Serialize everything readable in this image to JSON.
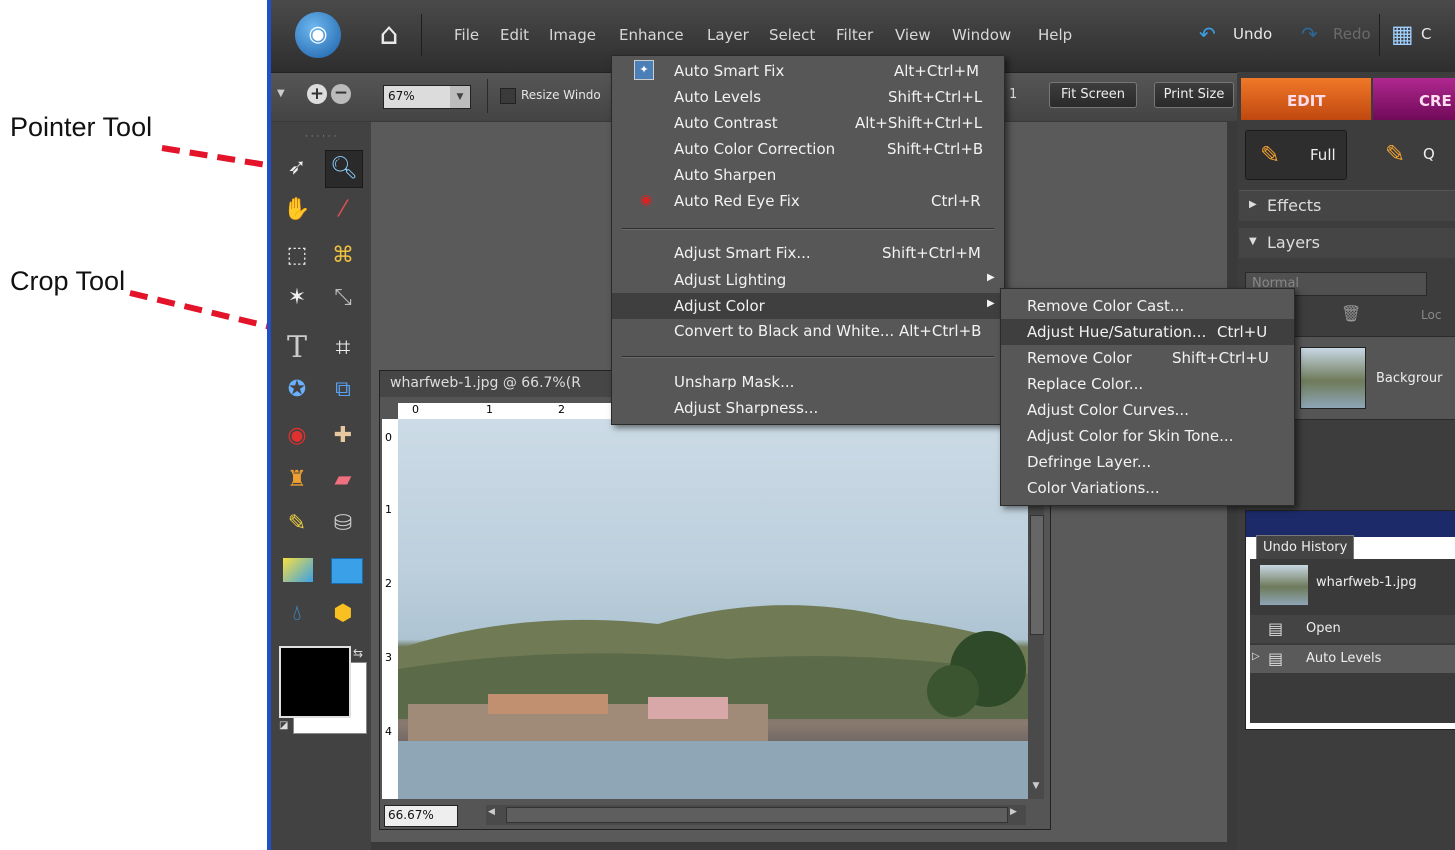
{
  "callouts": {
    "pointer": "Pointer Tool",
    "crop": "Crop Tool"
  },
  "menubar": {
    "items": [
      "File",
      "Edit",
      "Image",
      "Enhance",
      "Layer",
      "Select",
      "Filter",
      "View",
      "Window",
      "Help"
    ],
    "undo": "Undo",
    "redo": "Redo",
    "organizer": "C"
  },
  "options": {
    "zoom": "67%",
    "resize_label": "Resize Windo",
    "fit_screen": "Fit Screen",
    "print_size": "Print Size",
    "partial": "1"
  },
  "tabs": {
    "edit": "EDIT",
    "create": "CRE"
  },
  "panel": {
    "full": "Full",
    "quick": "Q",
    "effects": "Effects",
    "layers": "Layers",
    "blend": "Normal",
    "lock": "Loc",
    "layer_name": "Backgrour"
  },
  "enhance_menu": [
    {
      "label": "Auto Smart Fix",
      "shortcut": "Alt+Ctrl+M"
    },
    {
      "label": "Auto Levels",
      "shortcut": "Shift+Ctrl+L"
    },
    {
      "label": "Auto Contrast",
      "shortcut": "Alt+Shift+Ctrl+L"
    },
    {
      "label": "Auto Color Correction",
      "shortcut": "Shift+Ctrl+B"
    },
    {
      "label": "Auto Sharpen",
      "shortcut": ""
    },
    {
      "label": "Auto Red Eye Fix",
      "shortcut": "Ctrl+R"
    },
    {
      "label": "Adjust Smart Fix...",
      "shortcut": "Shift+Ctrl+M"
    },
    {
      "label": "Adjust Lighting",
      "shortcut": ""
    },
    {
      "label": "Adjust Color",
      "shortcut": ""
    },
    {
      "label": "Convert to Black and White...",
      "shortcut": "Alt+Ctrl+B"
    },
    {
      "label": "Unsharp Mask...",
      "shortcut": ""
    },
    {
      "label": "Adjust Sharpness...",
      "shortcut": ""
    }
  ],
  "color_submenu": [
    {
      "label": "Remove Color Cast...",
      "shortcut": ""
    },
    {
      "label": "Adjust Hue/Saturation...",
      "shortcut": "Ctrl+U"
    },
    {
      "label": "Remove Color",
      "shortcut": "Shift+Ctrl+U"
    },
    {
      "label": "Replace Color...",
      "shortcut": ""
    },
    {
      "label": "Adjust Color Curves...",
      "shortcut": ""
    },
    {
      "label": "Adjust Color for Skin Tone...",
      "shortcut": ""
    },
    {
      "label": "Defringe Layer...",
      "shortcut": ""
    },
    {
      "label": "Color Variations...",
      "shortcut": ""
    }
  ],
  "document": {
    "title": "wharfweb-1.jpg @ 66.7%(R",
    "zoom_status": "66.67%",
    "ruler_h": [
      "0",
      "1",
      "2"
    ],
    "ruler_v": [
      "0",
      "1",
      "2",
      "3",
      "4"
    ]
  },
  "undo_history": {
    "title": "Undo History",
    "items": [
      "wharfweb-1.jpg",
      "Open",
      "Auto Levels"
    ]
  }
}
